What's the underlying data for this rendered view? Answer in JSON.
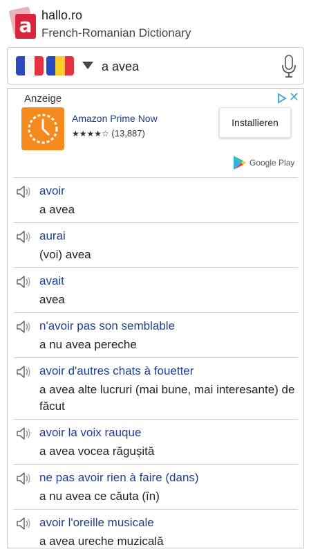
{
  "app": {
    "name": "hallo.ro",
    "subtitle": "French-Romanian Dictionary",
    "logo_letter": "a"
  },
  "search": {
    "source_flag": "flag-fr",
    "target_flag": "flag-ro",
    "query": "a avea"
  },
  "ad": {
    "label": "Anzeige",
    "app_title": "Amazon Prime Now",
    "stars": "★★★★☆",
    "rating_count": "(13,887)",
    "rating_value": 4,
    "install_label": "Installieren",
    "store_label": "Google Play",
    "close_glyph": "✕",
    "icon_color": "#f58a1f"
  },
  "entries": [
    {
      "fr": "avoir",
      "ro": "a avea"
    },
    {
      "fr": "aurai",
      "ro": "(voi) avea"
    },
    {
      "fr": "avait",
      "ro": "avea"
    },
    {
      "fr": "n'avoir pas son semblable",
      "ro": "a nu avea pereche"
    },
    {
      "fr": "avoir d'autres chats à fouetter",
      "ro": "a avea alte lucruri (mai bune, mai interesante) de făcut"
    },
    {
      "fr": "avoir la voix rauque",
      "ro": "a avea vocea răgușită"
    },
    {
      "fr": "ne pas avoir rien à faire (dans)",
      "ro": "a nu avea ce căuta (în)"
    },
    {
      "fr": "avoir l'oreille musicale",
      "ro": "a avea ureche muzicală"
    }
  ],
  "colors": {
    "accent_link": "#1f3f8f",
    "logo_red": "#d9263d"
  }
}
